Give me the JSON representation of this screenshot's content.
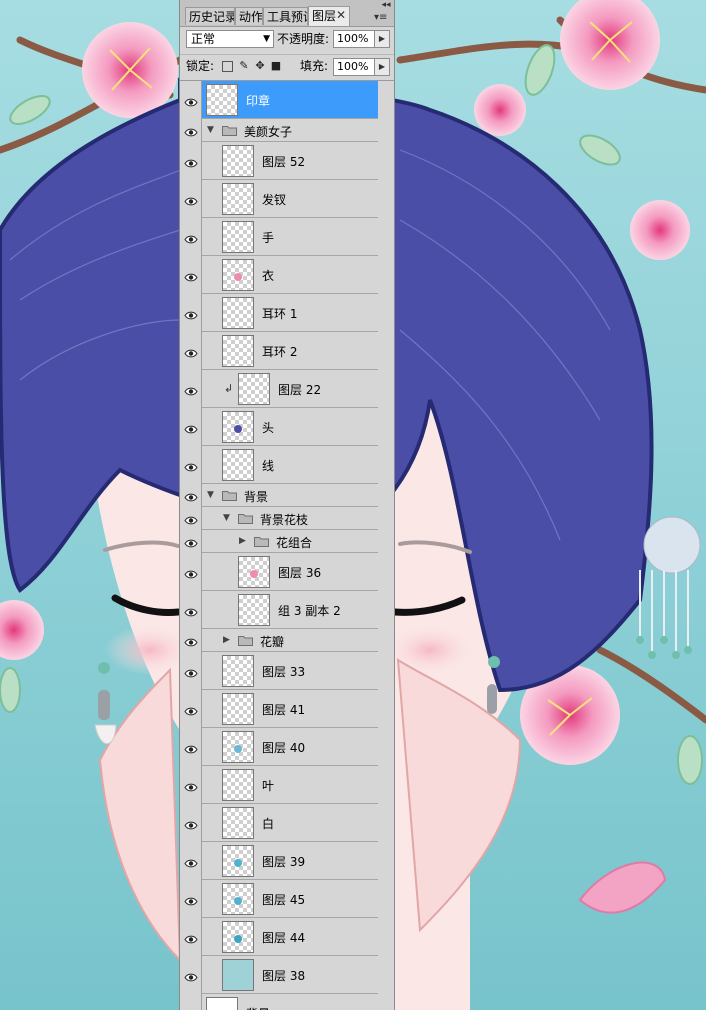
{
  "tabs": [
    {
      "label": "历史记录",
      "active": false
    },
    {
      "label": "动作",
      "active": false
    },
    {
      "label": "工具预设",
      "active": false
    },
    {
      "label": "图层",
      "active": true
    }
  ],
  "tab_close": "✕",
  "panel_close": "◂◂",
  "panel_menu": "▾≡",
  "blend_mode": "正常",
  "opacity_label": "不透明度:",
  "opacity_value": "100%",
  "lock_label": "锁定:",
  "fill_label": "填充:",
  "fill_value": "100%",
  "layers": [
    {
      "name": "印章",
      "selected": true
    },
    {
      "name": "美颜女子",
      "group": true
    },
    {
      "name": "图层 52"
    },
    {
      "name": "发钗"
    },
    {
      "name": "手"
    },
    {
      "name": "衣"
    },
    {
      "name": "耳环 1"
    },
    {
      "name": "耳环 2"
    },
    {
      "name": "图层 22",
      "clipped": true
    },
    {
      "name": "头"
    },
    {
      "name": "线"
    },
    {
      "name": "背景",
      "group": true
    },
    {
      "name": "背景花枝",
      "group": true
    },
    {
      "name": "花组合",
      "group": true,
      "collapsed": true
    },
    {
      "name": "图层 36"
    },
    {
      "name": "组 3 副本 2"
    },
    {
      "name": "花瓣",
      "group": true,
      "collapsed": true
    },
    {
      "name": "图层 33"
    },
    {
      "name": "图层 41"
    },
    {
      "name": "图层 40"
    },
    {
      "name": "叶"
    },
    {
      "name": "白"
    },
    {
      "name": "图层 39"
    },
    {
      "name": "图层 45"
    },
    {
      "name": "图层 44"
    },
    {
      "name": "图层 38"
    },
    {
      "name": "背景"
    }
  ],
  "colors": {
    "sky": "#8ccfd6",
    "hair": "#4a4ea6",
    "skin": "#fbe4e4",
    "blossom": "#f3a4c4",
    "selection": "#3d9cfb"
  }
}
